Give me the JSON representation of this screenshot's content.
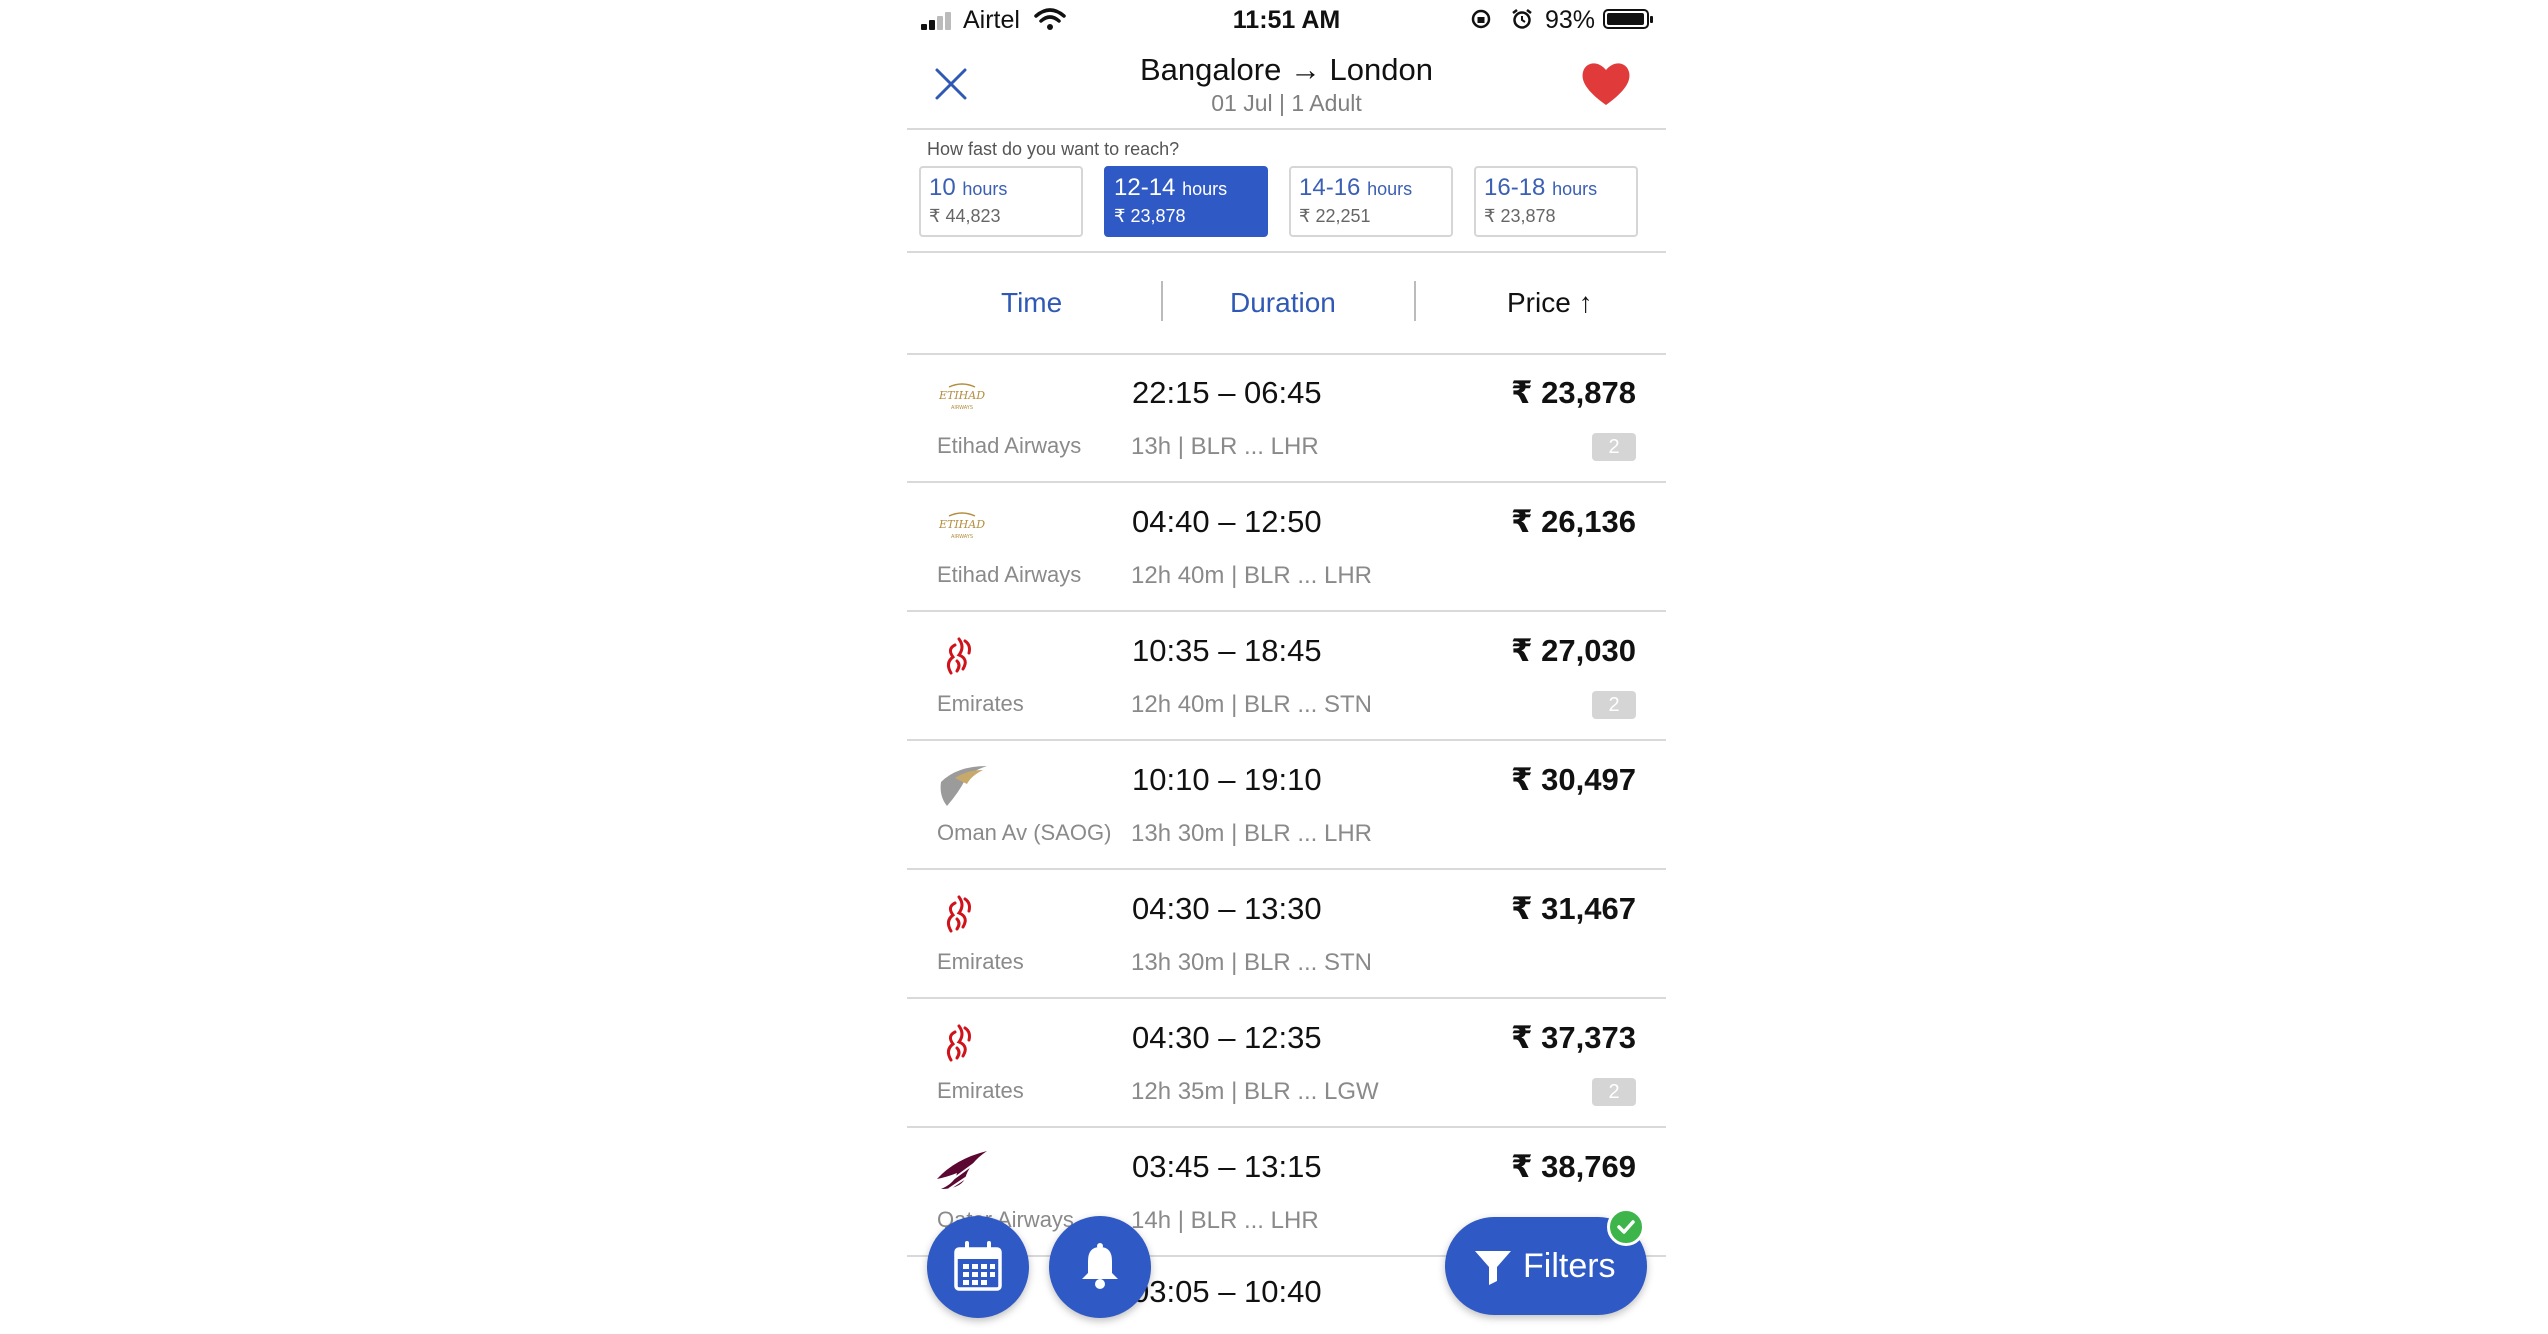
{
  "status_bar": {
    "carrier": "Airtel",
    "time": "11:51 AM",
    "battery_percent": "93%"
  },
  "header": {
    "title": "Bangalore → London",
    "subtitle": "01 Jul | 1 Adult"
  },
  "speed_filter": {
    "label": "How fast do you want to reach?",
    "options": [
      {
        "range": "10",
        "unit": "hours",
        "price": "₹ 44,823",
        "selected": false
      },
      {
        "range": "12-14",
        "unit": "hours",
        "price": "₹ 23,878",
        "selected": true
      },
      {
        "range": "14-16",
        "unit": "hours",
        "price": "₹ 22,251",
        "selected": false
      },
      {
        "range": "16-18",
        "unit": "hours",
        "price": "₹ 23,878",
        "selected": false
      }
    ]
  },
  "sort_bar": {
    "time": "Time",
    "duration": "Duration",
    "price": "Price ↑"
  },
  "flights": [
    {
      "airline": "Etihad Airways",
      "logo": "etihad-logo",
      "times": "22:15 – 06:45",
      "meta": "13h  | BLR ... LHR",
      "price": "₹ 23,878",
      "stops": "2"
    },
    {
      "airline": "Etihad Airways",
      "logo": "etihad-logo",
      "times": "04:40 – 12:50",
      "meta": "12h 40m  | BLR ... LHR",
      "price": "₹ 26,136",
      "stops": ""
    },
    {
      "airline": "Emirates",
      "logo": "emirates-logo",
      "times": "10:35 – 18:45",
      "meta": "12h 40m  | BLR ... STN",
      "price": "₹ 27,030",
      "stops": "2"
    },
    {
      "airline": "Oman Av (SAOG)",
      "logo": "oman-air-logo",
      "times": "10:10 – 19:10",
      "meta": "13h 30m  | BLR ... LHR",
      "price": "₹ 30,497",
      "stops": ""
    },
    {
      "airline": "Emirates",
      "logo": "emirates-logo",
      "times": "04:30 – 13:30",
      "meta": "13h 30m  | BLR ... STN",
      "price": "₹ 31,467",
      "stops": ""
    },
    {
      "airline": "Emirates",
      "logo": "emirates-logo",
      "times": "04:30 – 12:35",
      "meta": "12h 35m  | BLR ... LGW",
      "price": "₹ 37,373",
      "stops": "2"
    },
    {
      "airline": "Qatar Airways",
      "logo": "qatar-logo",
      "times": "03:45 – 13:15",
      "meta": "14h  | BLR ... LHR",
      "price": "₹ 38,769",
      "stops": ""
    },
    {
      "airline": "",
      "logo": "",
      "times": "03:05 – 10:40",
      "meta": "",
      "price": "",
      "stops": ""
    }
  ],
  "floating": {
    "filters_label": "Filters"
  },
  "colors": {
    "accent": "#2f59c4",
    "heart": "#e03a3a",
    "check": "#3db54a"
  }
}
